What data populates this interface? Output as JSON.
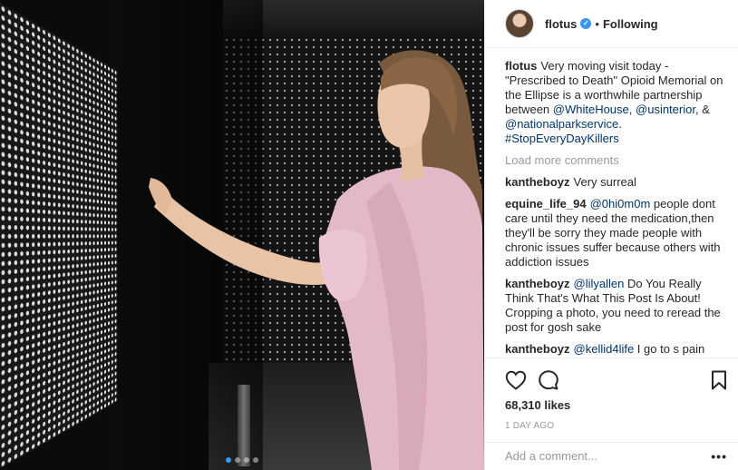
{
  "post": {
    "username": "flotus",
    "separator": "•",
    "follow_state": "Following",
    "carousel": {
      "total_slides": 4,
      "active_slide": 1
    }
  },
  "caption": {
    "username": "flotus",
    "text_1": "Very moving visit today - \"Prescribed to Death\" Opioid Memorial on the Ellipse is a worthwhile partnership between ",
    "mention_1": "@WhiteHouse",
    "text_2": ", ",
    "mention_2": "@usinterior",
    "text_3": ", & ",
    "mention_3": "@nationalparkservice",
    "text_4": ". ",
    "hashtag": "#StopEveryDayKillers"
  },
  "load_more": "Load more comments",
  "comments": [
    {
      "username": "kantheboyz",
      "mention": "",
      "text": "Very surreal"
    },
    {
      "username": "equine_life_94",
      "mention": "@0hi0m0m",
      "text": " people dont care until they need the medication,then they'll be sorry they made people with chronic issues suffer because others with addiction issues"
    },
    {
      "username": "kantheboyz",
      "mention": "@lilyallen",
      "text": " Do You Really Think That's What This Post Is About! Cropping a photo, you need to reread the post for gosh sake"
    },
    {
      "username": "kantheboyz",
      "mention": "@kellid4life",
      "text": " I go to s pain management Dr. You have to go to the"
    }
  ],
  "actions": {
    "likes": "68,310 likes",
    "time": "1 DAY AGO"
  },
  "add_comment": {
    "placeholder": "Add a comment...",
    "more": "•••"
  },
  "colors": {
    "link": "#003569",
    "verified": "#3897f0",
    "muted": "#999999"
  }
}
